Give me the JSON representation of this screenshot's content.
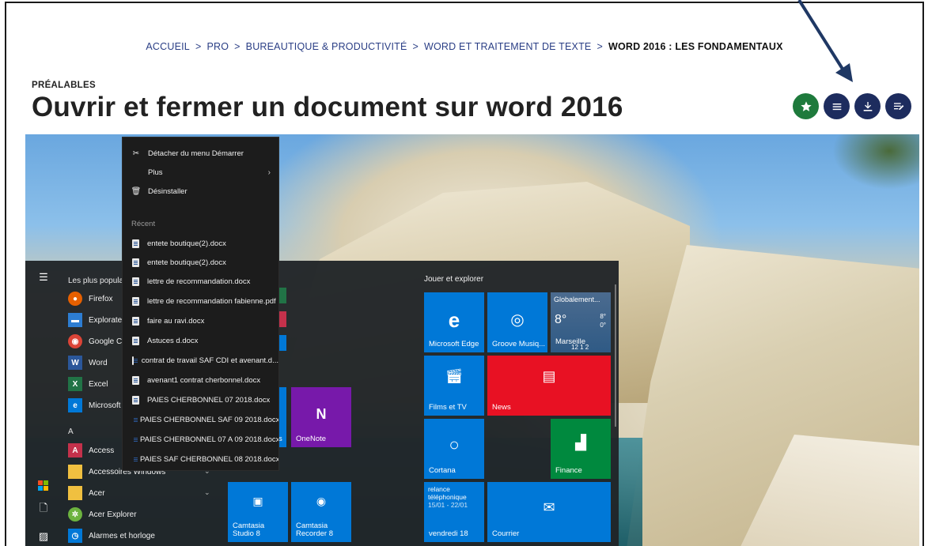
{
  "breadcrumb": {
    "items": [
      "ACCUEIL",
      "PRO",
      "BUREAUTIQUE & PRODUCTIVITÉ",
      "WORD ET TRAITEMENT DE TEXTE"
    ],
    "current": "WORD 2016 : LES FONDAMENTAUX",
    "separator": ">"
  },
  "header": {
    "kicker": "PRÉALABLES",
    "title": "Ouvrir et fermer un document sur word 2016"
  },
  "actions": [
    {
      "icon": "star-icon",
      "color": "#1e7a3c"
    },
    {
      "icon": "menu-icon",
      "color": "#1d2c5e"
    },
    {
      "icon": "download-icon",
      "color": "#1d2c5e"
    },
    {
      "icon": "edit-note-icon",
      "color": "#1d2c5e"
    }
  ],
  "start_menu": {
    "list_header": "Les plus populair",
    "apps": [
      {
        "label": "Firefox",
        "icon": "firefox-icon",
        "color": "#e66000"
      },
      {
        "label": "Explorate",
        "icon": "file-explorer-icon",
        "color": "#2d7dd2"
      },
      {
        "label": "Google C",
        "icon": "chrome-icon",
        "color": "#db4437"
      },
      {
        "label": "Word",
        "icon": "word-icon",
        "color": "#2b579a"
      },
      {
        "label": "Excel",
        "icon": "excel-icon",
        "color": "#217346"
      },
      {
        "label": "Microsoft",
        "icon": "edge-icon",
        "color": "#0078d7"
      }
    ],
    "letter_a": "A",
    "apps_a": [
      {
        "label": "Access",
        "icon": "access-icon",
        "color": "#c4314b"
      },
      {
        "label": "Accessoires Windows",
        "icon": "folder-icon",
        "color": "#f0c040"
      },
      {
        "label": "Acer",
        "icon": "folder-icon",
        "color": "#f0c040"
      },
      {
        "label": "Acer Explorer",
        "icon": "acer-explorer-icon",
        "color": "#6cb33f"
      },
      {
        "label": "Alarmes et horloge",
        "icon": "alarm-icon",
        "color": "#0078d7"
      }
    ],
    "group_title": "Jouer et explorer",
    "tiles": {
      "edge": "Microsoft Edge",
      "groove": "Groove Musiq...",
      "weather_top": "Globalement...",
      "weather_temp": "8°",
      "weather_hi": "8°",
      "weather_lo": "0°",
      "weather_city": "Marseille",
      "weather_extra": "12   1   2",
      "films": "Films et TV",
      "news": "News",
      "onenote": "OneNote",
      "cortana": "Cortana",
      "finance": "Finance",
      "camtasia_studio": "Camtasia\nStudio 8",
      "camtasia_recorder": "Camtasia\nRecorder 8",
      "calendar_line1": "relance",
      "calendar_line2": "téléphonique",
      "calendar_line3": "15/01 - 22/01",
      "calendar_day": "vendredi 18",
      "mail": "Courrier",
      "partial_left": "s"
    }
  },
  "context_menu": {
    "unpin": "Détacher du menu Démarrer",
    "more": "Plus",
    "uninstall": "Désinstaller",
    "recent_header": "Récent",
    "recent": [
      "entete boutique(2).docx",
      "entete boutique(2).docx",
      "lettre de recommandation.docx",
      "lettre de recommandation fabienne.pdf",
      "faire au ravi.docx",
      "Astuces d.docx",
      "contrat de travail SAF CDI et avenant.d...",
      "avenant1 contrat cherbonnel.docx",
      "PAIES CHERBONNEL 07 2018.docx",
      "PAIES CHERBONNEL SAF 09 2018.docx",
      "PAIES CHERBONNEL 07 A 09 2018.docx",
      "PAIES SAF CHERBONNEL 08 2018.docx"
    ]
  },
  "colors": {
    "brand_blue": "#2a3e85",
    "button_navy": "#1d2c5e",
    "button_green": "#1e7a3c",
    "arrow": "#1f3864"
  }
}
